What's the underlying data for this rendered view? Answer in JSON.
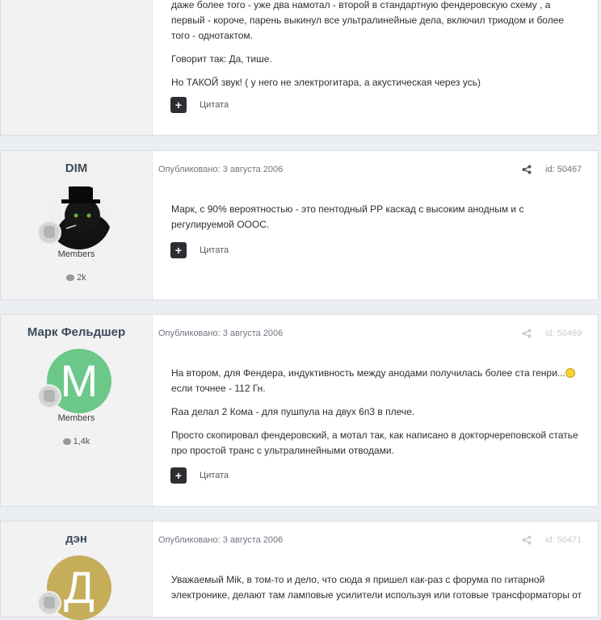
{
  "posts": [
    {
      "content": [
        "даже более того - уже два намотал - второй в стандартную фендеровскую схему , а первый - короче, парень выкинул все ультралинейные дела, включил триодом и более того - однотактом.",
        "Говорит так: Да, тише.",
        "Но ТАКОЙ звук! ( у него не электрогитара, а акустическая через усь)"
      ],
      "quote_label": "Цитата"
    },
    {
      "author": "DIM",
      "rank": "Members",
      "post_count": "2k",
      "published": "Опубликовано: 3 августа 2006",
      "post_id": "id: 50467",
      "content": [
        "Марк, с 90% вероятностью - это пентодный РР каскад с высоким анодным и с регулируемой ОООС."
      ],
      "quote_label": "Цитата"
    },
    {
      "author": "Марк Фельдшер",
      "avatar_letter": "М",
      "avatar_color": "#6cc889",
      "rank": "Members",
      "post_count": "1,4k",
      "published": "Опубликовано: 3 августа 2006",
      "post_id": "id: 50469",
      "content": [
        "На втором, для Фендера, индуктивность между анодами получилась более ста генри...",
        "если точнее - 112 Гн.",
        "Raa делал 2 Кома - для пушпула на двух 6п3 в плече.",
        "Просто скопировал фендеровский, а мотал так, как написано в докторчереповской статье про простой транс с ультралинейными отводами."
      ],
      "quote_label": "Цитата"
    },
    {
      "author": "дэн",
      "avatar_letter": "Д",
      "avatar_color": "#c5ad5a",
      "published": "Опубликовано: 3 августа 2006",
      "post_id": "id: 50471",
      "content": [
        "Уважаемый Mik, в том-то и дело, что сюда я пришел как-раз с форума по гитарной электронике, делают там ламповые усилители используя или готовые трансформаторы от"
      ]
    }
  ]
}
